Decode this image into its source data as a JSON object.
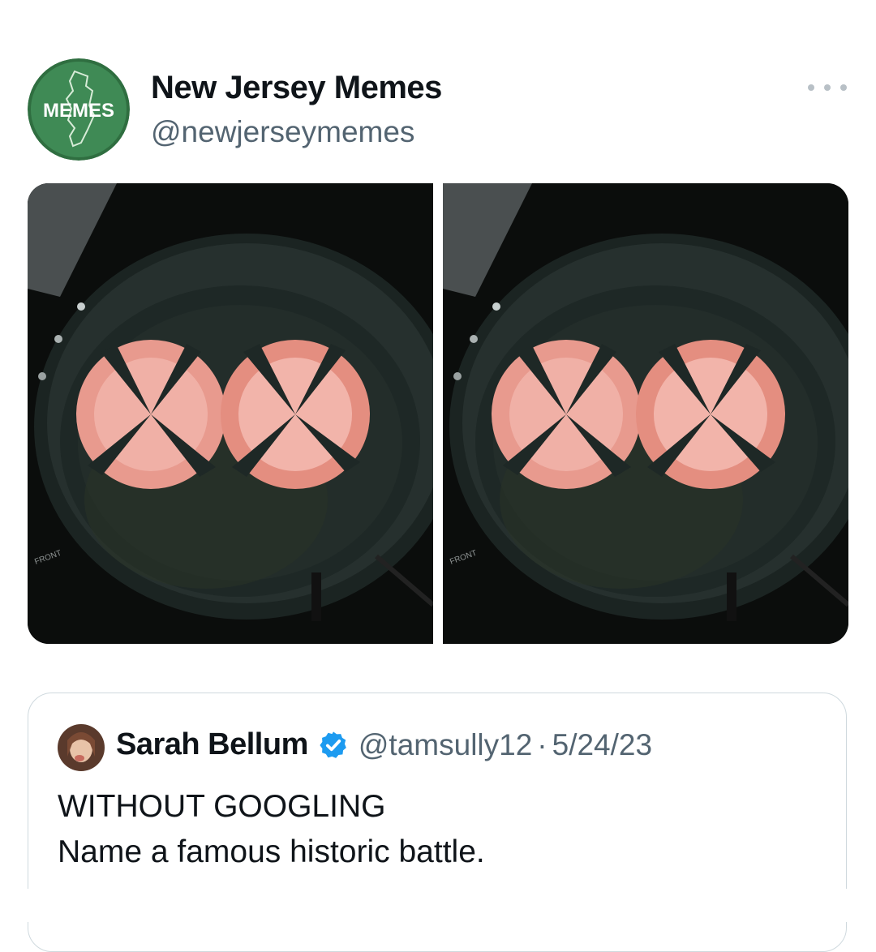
{
  "author": {
    "name": "New Jersey Memes",
    "handle": "@newjerseymemes",
    "avatar_text": "MEMES"
  },
  "menu": {
    "more_icon": "more-horizontal-icon"
  },
  "media": {
    "photos": [
      {
        "name": "frying-pan-photo-left",
        "stove_label": "FRONT"
      },
      {
        "name": "frying-pan-photo-right",
        "stove_label": "FRONT"
      }
    ]
  },
  "quoted_tweet": {
    "name": "Sarah Bellum",
    "verified_icon": "verified-badge-icon",
    "handle": "@tamsully12",
    "separator": "·",
    "date": "5/24/23",
    "line1": "WITHOUT GOOGLING",
    "line2": "Name a famous historic battle."
  },
  "colors": {
    "brand_green": "#3f8a55",
    "secondary_text": "#536471",
    "verified_blue": "#1d9bf0",
    "border": "#cfd9de"
  }
}
